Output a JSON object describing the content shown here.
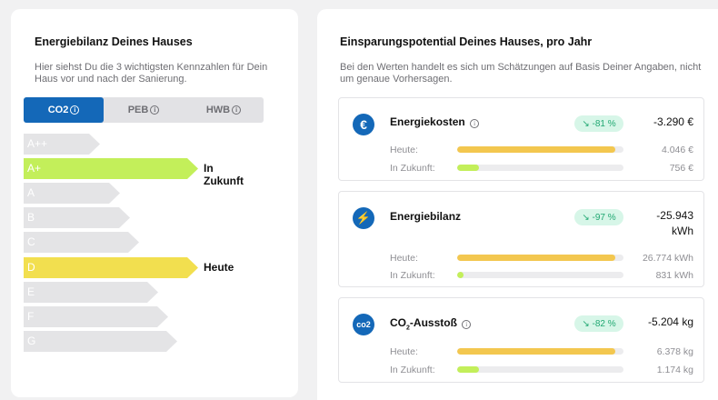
{
  "left": {
    "title": "Energiebilanz Deines Hauses",
    "description": "Hier siehst Du die 3 wichtigsten Kennzahlen für Dein Haus vor und nach der Sanierung.",
    "tabs": [
      {
        "label": "CO2",
        "active": true
      },
      {
        "label": "PEB",
        "active": false
      },
      {
        "label": "HWB",
        "active": false
      }
    ],
    "scale": [
      {
        "label": "A++"
      },
      {
        "label": "A+",
        "marker": "In Zukunft"
      },
      {
        "label": "A"
      },
      {
        "label": "B"
      },
      {
        "label": "C"
      },
      {
        "label": "D",
        "marker": "Heute"
      },
      {
        "label": "E"
      },
      {
        "label": "F"
      },
      {
        "label": "G"
      }
    ]
  },
  "right": {
    "title": "Einsparungspotential Deines Hauses, pro Jahr",
    "description": "Bei den Werten handelt es sich um Schätzungen auf Basis Deiner Angaben, nicht um genaue Vorhersagen.",
    "cards": [
      {
        "icon": "euro-icon",
        "icon_text": "€",
        "title": "Energiekosten",
        "badge": "↘ -81 %",
        "value_line1": "-3.290 €",
        "value_line2": "",
        "today_label": "Heute:",
        "today_value": "4.046 €",
        "today_fraction": 0.95,
        "future_label": "In Zukunft:",
        "future_value": "756 €",
        "future_fraction": 0.13
      },
      {
        "icon": "lightning-icon",
        "icon_text": "⚡",
        "title": "Energiebilanz",
        "badge": "↘ -97 %",
        "value_line1": "-25.943",
        "value_line2": "kWh",
        "today_label": "Heute:",
        "today_value": "26.774 kWh",
        "today_fraction": 0.95,
        "future_label": "In Zukunft:",
        "future_value": "831 kWh",
        "future_fraction": 0.04
      },
      {
        "icon": "co2-icon",
        "icon_text": "co2",
        "title": "CO",
        "title_sub": "2",
        "title_rest": "-Ausstoß",
        "badge": "↘ -82 %",
        "value_line1": "-5.204 kg",
        "value_line2": "",
        "today_label": "Heute:",
        "today_value": "6.378 kg",
        "today_fraction": 0.95,
        "future_label": "In Zukunft:",
        "future_value": "1.174 kg",
        "future_fraction": 0.13
      }
    ]
  },
  "colors": {
    "accent": "#1468b8",
    "future": "#c3ef5a",
    "today": "#f2df4f",
    "badge_bg": "#d7f6e8",
    "badge_text": "#21a872"
  }
}
